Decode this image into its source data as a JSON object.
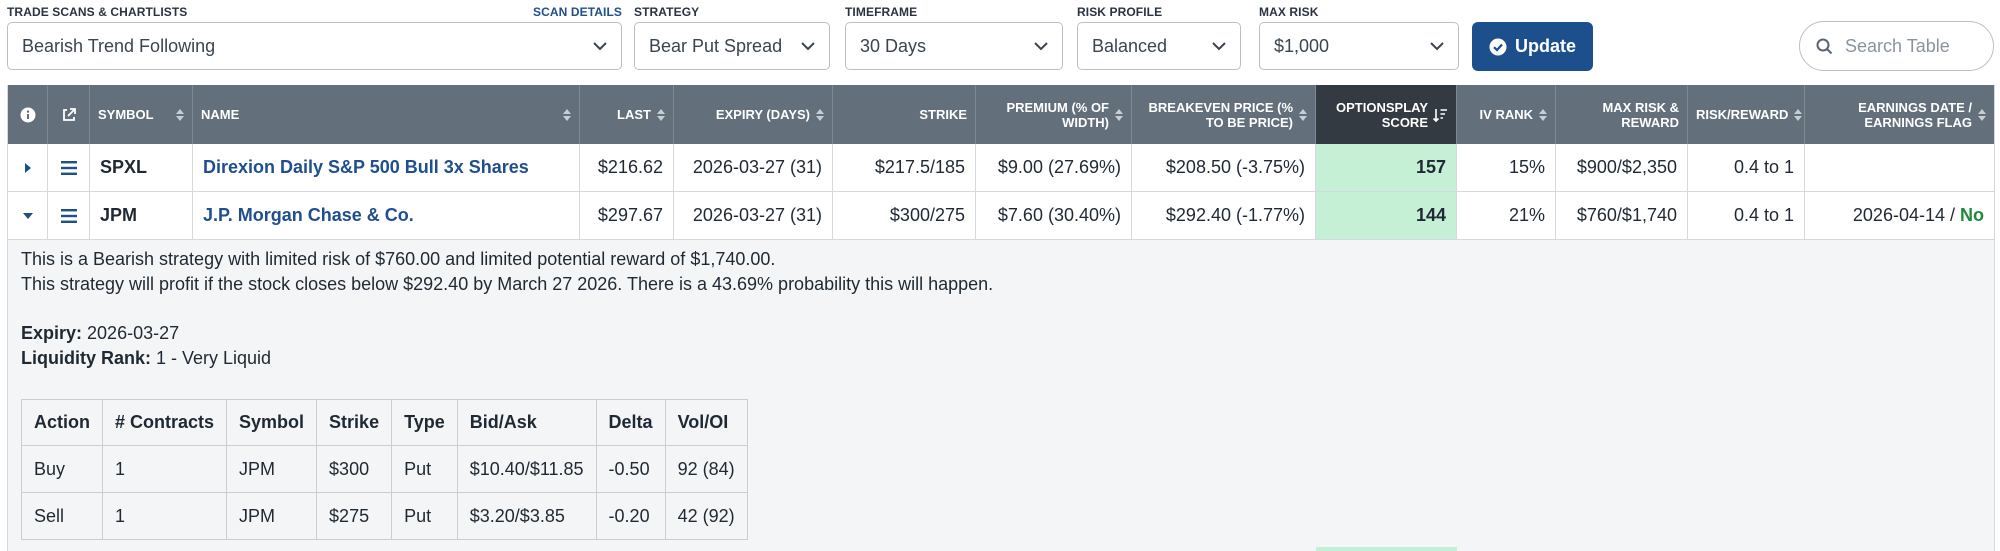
{
  "filters": {
    "scan": {
      "label": "Trade Scans & Chartlists",
      "link": "Scan Details",
      "value": "Bearish Trend Following"
    },
    "strategy": {
      "label": "Strategy",
      "value": "Bear Put Spread"
    },
    "timeframe": {
      "label": "Timeframe",
      "value": "30 Days"
    },
    "risk_profile": {
      "label": "Risk Profile",
      "value": "Balanced"
    },
    "max_risk": {
      "label": "Max Risk",
      "value": "$1,000"
    }
  },
  "update_button": {
    "label": "Update"
  },
  "search": {
    "placeholder": "Search Table"
  },
  "table": {
    "columns": [
      {
        "key": "info",
        "label": ""
      },
      {
        "key": "open",
        "label": ""
      },
      {
        "key": "symbol",
        "label": "Symbol"
      },
      {
        "key": "name",
        "label": "Name"
      },
      {
        "key": "last",
        "label": "Last"
      },
      {
        "key": "expiry",
        "label": "Expiry (Days)"
      },
      {
        "key": "strike",
        "label": "Strike"
      },
      {
        "key": "premium",
        "label": "Premium (% of Width)"
      },
      {
        "key": "breakeven",
        "label": "Breakeven Price (% to be Price)"
      },
      {
        "key": "score",
        "label": "OptionsPlay Score"
      },
      {
        "key": "iv_rank",
        "label": "IV Rank"
      },
      {
        "key": "max_risk_reward",
        "label": "Max Risk & Reward"
      },
      {
        "key": "risk_reward",
        "label": "Risk/Reward"
      },
      {
        "key": "earnings",
        "label": "Earnings Date / Earnings Flag"
      }
    ],
    "rows": [
      {
        "symbol": "SPXL",
        "name": "Direxion Daily S&P 500 Bull 3x Shares",
        "last": "$216.62",
        "expiry": "2026-03-27 (31)",
        "strike": "$217.5/185",
        "premium": "$9.00 (27.69%)",
        "breakeven": "$208.50 (-3.75%)",
        "score": "157",
        "iv_rank": "15%",
        "max_risk_reward": "$900/$2,350",
        "risk_reward": "0.4 to 1",
        "earnings_date": "",
        "earnings_sep": "",
        "earnings_flag": "",
        "expanded": false
      },
      {
        "symbol": "JPM",
        "name": "J.P. Morgan Chase & Co.",
        "last": "$297.67",
        "expiry": "2026-03-27 (31)",
        "strike": "$300/275",
        "premium": "$7.60 (30.40%)",
        "breakeven": "$292.40 (-1.77%)",
        "score": "144",
        "iv_rank": "21%",
        "max_risk_reward": "$760/$1,740",
        "risk_reward": "0.4 to 1",
        "earnings_date": "2026-04-14",
        "earnings_sep": " / ",
        "earnings_flag": "No",
        "expanded": true
      }
    ]
  },
  "detail": {
    "summary_1": "This is a Bearish strategy with limited risk of $760.00 and limited potential reward of $1,740.00.",
    "summary_2": "This strategy will profit if the stock closes below $292.40 by March 27 2026. There is a 43.69% probability this will happen.",
    "expiry_label": "Expiry:",
    "expiry_value": " 2026-03-27",
    "liquidity_label": "Liquidity Rank:",
    "liquidity_value": " 1 - Very Liquid",
    "legs": {
      "headers": [
        "Action",
        "# Contracts",
        "Symbol",
        "Strike",
        "Type",
        "Bid/Ask",
        "Delta",
        "Vol/OI"
      ],
      "rows": [
        [
          "Buy",
          "1",
          "JPM",
          "$300",
          "Put",
          "$10.40/$11.85",
          "-0.50",
          "92 (84)"
        ],
        [
          "Sell",
          "1",
          "JPM",
          "$275",
          "Put",
          "$3.20/$3.85",
          "-0.20",
          "42 (92)"
        ]
      ]
    }
  },
  "colors": {
    "header_bg": "#636f7b",
    "active_header_bg": "#343a41",
    "accent": "#1d4f8c",
    "score_bg": "#c6f0d6",
    "flag_no": "#1e8a3c",
    "link": "#1f4f8f"
  }
}
